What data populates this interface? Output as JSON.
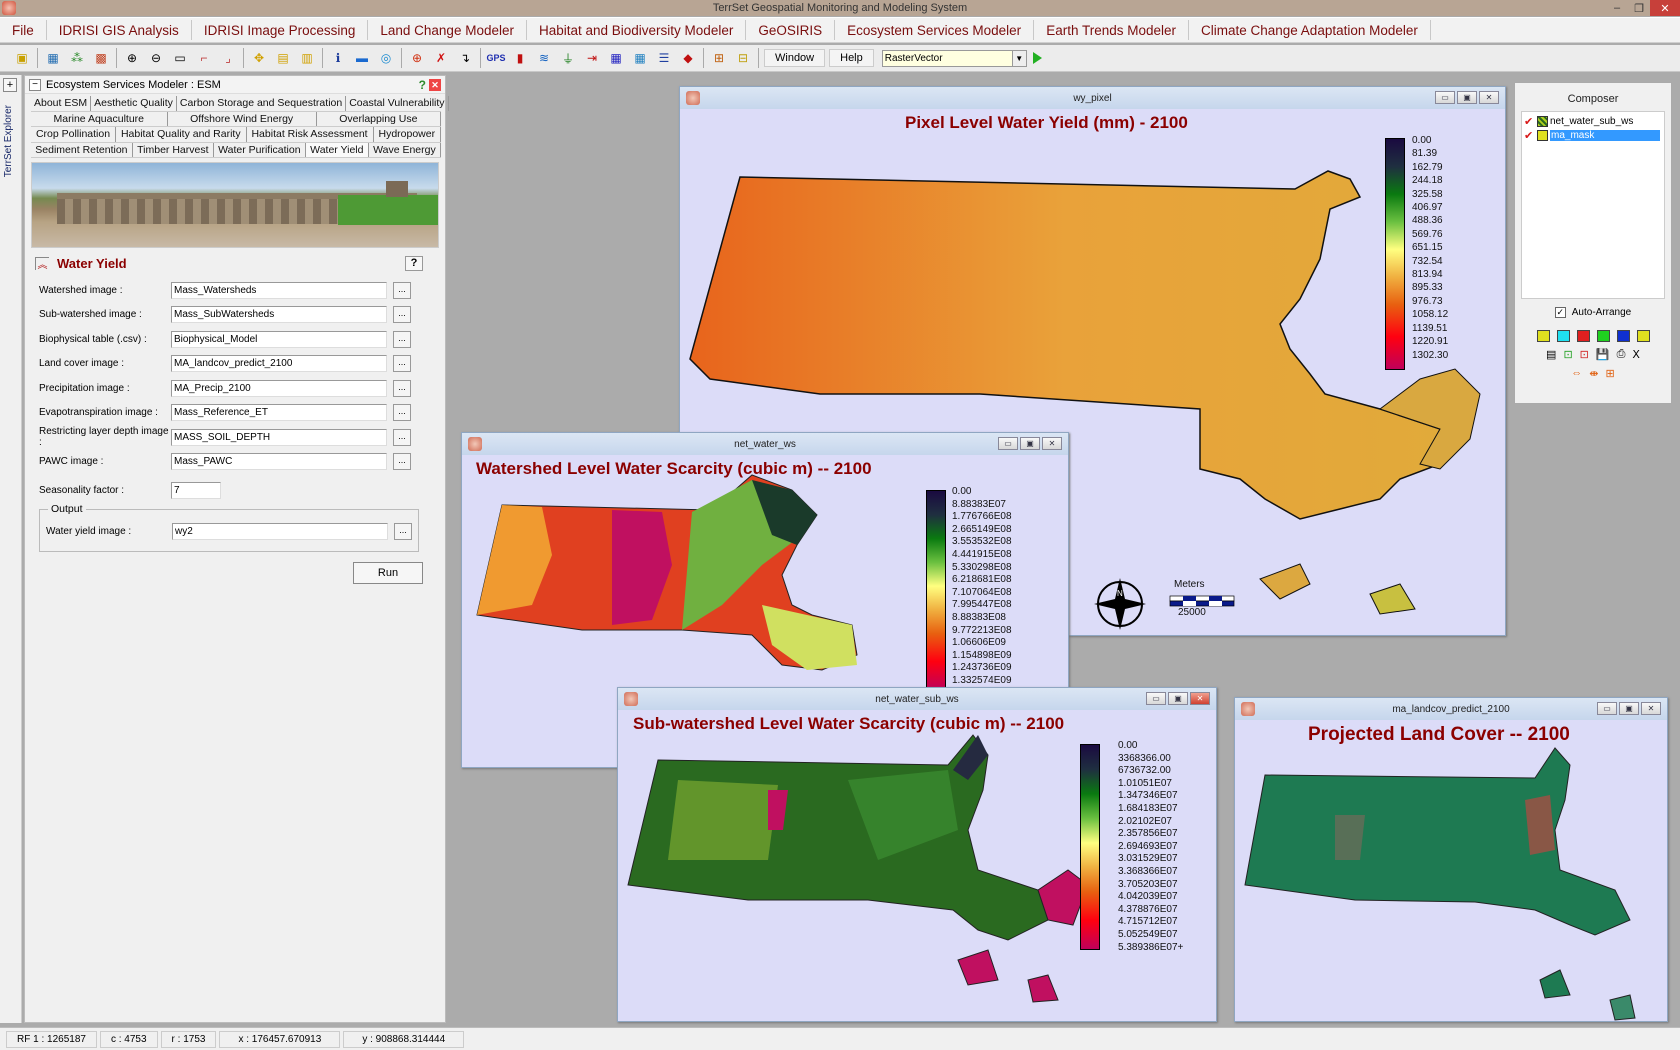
{
  "app": {
    "title": "TerrSet Geospatial Monitoring and Modeling System"
  },
  "menu": [
    "File",
    "IDRISI  GIS Analysis",
    "IDRISI  Image Processing",
    "Land Change Modeler",
    "Habitat and Biodiversity Modeler",
    "GeOSIRIS",
    "Ecosystem Services Modeler",
    "Earth Trends Modeler",
    "Climate Change Adaptation Modeler"
  ],
  "toolbar": {
    "window_label": "Window",
    "help_label": "Help",
    "combo_value": "RasterVector"
  },
  "explorer": {
    "label": "TerrSet Explorer"
  },
  "panel": {
    "title": "Ecosystem Services Modeler : ESM",
    "tabs": [
      [
        "About ESM",
        "Aesthetic Quality",
        "Carbon Storage and Sequestration",
        "Coastal Vulnerability"
      ],
      [
        "Marine Aquaculture",
        "Offshore Wind Energy",
        "Overlapping Use"
      ],
      [
        "Crop Pollination",
        "Habitat Quality and Rarity",
        "Habitat Risk Assessment",
        "Hydropower"
      ],
      [
        "Sediment Retention",
        "Timber Harvest",
        "Water Purification",
        "Water Yield",
        "Wave Energy"
      ]
    ],
    "active_tab": "Water Yield",
    "form_title": "Water Yield",
    "help_btn": "?",
    "fields": [
      {
        "label": "Watershed image :",
        "value": "Mass_Watersheds"
      },
      {
        "label": "Sub-watershed image :",
        "value": "Mass_SubWatersheds"
      },
      {
        "label": "Biophysical table (.csv) :",
        "value": "Biophysical_Model"
      },
      {
        "label": "Land cover image :",
        "value": "MA_landcov_predict_2100"
      },
      {
        "label": "Precipitation image :",
        "value": "MA_Precip_2100"
      },
      {
        "label": "Evapotranspiration image :",
        "value": "Mass_Reference_ET"
      },
      {
        "label": "Restricting layer depth image :",
        "value": "MASS_SOIL_DEPTH"
      },
      {
        "label": "PAWC image :",
        "value": "Mass_PAWC"
      }
    ],
    "seasonality": {
      "label": "Seasonality factor :",
      "value": "7"
    },
    "output": {
      "legend": "Output",
      "label": "Water yield image :",
      "value": "wy2"
    },
    "browse": "...",
    "run_label": "Run"
  },
  "windows": {
    "wy_pixel": {
      "caption": "wy_pixel",
      "title": "Pixel Level Water Yield (mm) - 2100",
      "legend": [
        "0.00",
        "81.39",
        "162.79",
        "244.18",
        "325.58",
        "406.97",
        "488.36",
        "569.76",
        "651.15",
        "732.54",
        "813.94",
        "895.33",
        "976.73",
        "1058.12",
        "1139.51",
        "1220.91",
        "1302.30"
      ],
      "scale_label": "Meters",
      "scale_value": "25000"
    },
    "net_water_ws": {
      "caption": "net_water_ws",
      "title": "Watershed Level Water Scarcity (cubic m) -- 2100",
      "legend": [
        "0.00",
        "8.88383E07",
        "1.776766E08",
        "2.665149E08",
        "3.553532E08",
        "4.441915E08",
        "5.330298E08",
        "6.218681E08",
        "7.107064E08",
        "7.995447E08",
        "8.88383E08",
        "9.772213E08",
        "1.06606E09",
        "1.154898E09",
        "1.243736E09",
        "1.332574E09"
      ]
    },
    "net_water_sub_ws": {
      "caption": "net_water_sub_ws",
      "title": "Sub-watershed Level Water Scarcity (cubic m) -- 2100",
      "legend": [
        "0.00",
        "3368366.00",
        "6736732.00",
        "1.01051E07",
        "1.347346E07",
        "1.684183E07",
        "2.02102E07",
        "2.357856E07",
        "2.694693E07",
        "3.031529E07",
        "3.368366E07",
        "3.705203E07",
        "4.042039E07",
        "4.378876E07",
        "4.715712E07",
        "5.052549E07",
        "5.389386E07+"
      ]
    },
    "landcov": {
      "caption": "ma_landcov_predict_2100",
      "title": "Projected Land Cover -- 2100"
    }
  },
  "composer": {
    "title": "Composer",
    "layers": [
      {
        "name": "net_water_sub_ws",
        "selected": false
      },
      {
        "name": "ma_mask",
        "selected": true
      }
    ],
    "auto_arrange": "Auto-Arrange"
  },
  "status": {
    "rf": "RF  1 : 1265187",
    "c": "c : 4753",
    "r": "r : 1753",
    "x": "x : 176457.670913",
    "y": "y : 908868.314444"
  },
  "colors": {
    "accent": "#8b0000",
    "menu_text": "#7a0e0e",
    "map_bg": "#dcdcf8"
  }
}
